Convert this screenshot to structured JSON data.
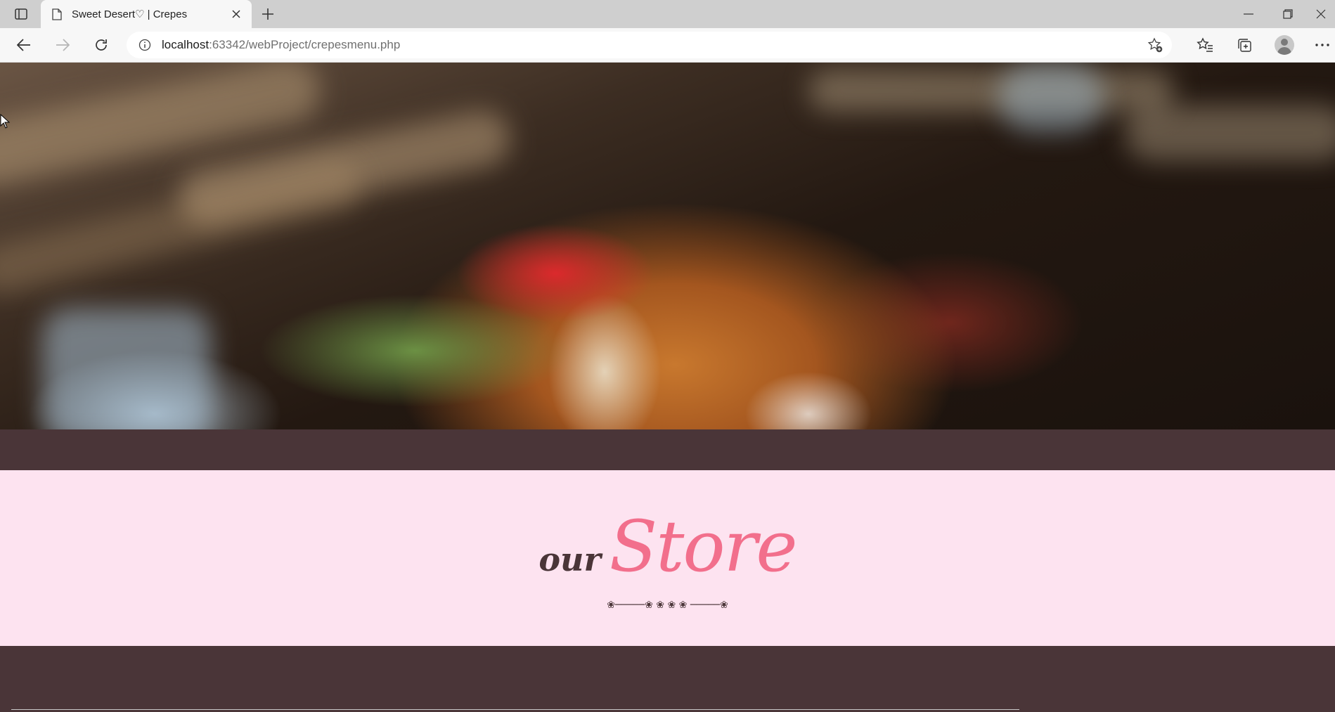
{
  "browser": {
    "tab_title": "Sweet Desert♡ | Crepes",
    "url_host": "localhost",
    "url_path": ":63342/webProject/crepesmenu.php"
  },
  "icons": {
    "tab_actions": "tab-actions-icon",
    "favicon": "page-icon",
    "tab_close": "close-icon",
    "new_tab": "plus-icon",
    "minimize": "minimize-icon",
    "restore": "restore-icon",
    "close_window": "close-icon",
    "back": "back-arrow-icon",
    "forward": "forward-arrow-icon",
    "refresh": "refresh-icon",
    "site_info": "info-icon",
    "add_favorite": "star-plus-icon",
    "favorites": "favorites-icon",
    "collections": "collections-icon",
    "profile": "avatar-icon",
    "more": "ellipsis-icon"
  },
  "page": {
    "store_heading_small": "our",
    "store_heading_big": "Store",
    "divider": "❀─────❀  ❀  ❀  ❀  ─────❀"
  },
  "colors": {
    "dark_band": "#4a3538",
    "pink_section": "#fde3f0",
    "accent_pink": "#f26f8c"
  }
}
